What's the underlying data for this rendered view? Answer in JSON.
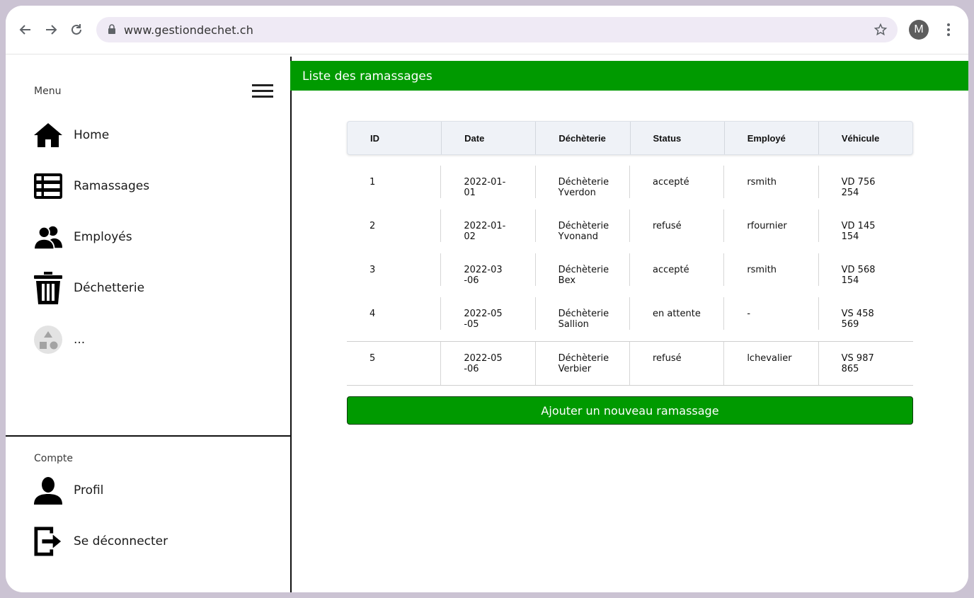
{
  "browser": {
    "url": "www.gestiondechet.ch",
    "avatar_letter": "M"
  },
  "sidebar": {
    "menu_label": "Menu",
    "items": [
      {
        "label": "Home",
        "icon": "home-icon"
      },
      {
        "label": "Ramassages",
        "icon": "list-icon"
      },
      {
        "label": "Employés",
        "icon": "users-icon"
      },
      {
        "label": "Déchetterie",
        "icon": "trash-icon"
      },
      {
        "label": "...",
        "icon": "shapes-icon"
      }
    ],
    "account_label": "Compte",
    "account_items": [
      {
        "label": "Profil",
        "icon": "user-icon"
      },
      {
        "label": "Se déconnecter",
        "icon": "logout-icon"
      }
    ]
  },
  "main": {
    "title": "Liste des ramassages",
    "table": {
      "headers": [
        "ID",
        "Date",
        "Déchèterie",
        "Status",
        "Employé",
        "Véhicule"
      ],
      "rows": [
        [
          "1",
          "2022-01-01",
          "Déchèterie Yverdon",
          "accepté",
          "rsmith",
          "VD 756 254"
        ],
        [
          "2",
          "2022-01-02",
          "Déchèterie Yvonand",
          "refusé",
          "rfournier",
          "VD 145 154"
        ],
        [
          "3",
          "2022-03 -06",
          "Déchèterie Bex",
          "accepté",
          "rsmith",
          "VD 568 154"
        ],
        [
          "4",
          "2022-05 -05",
          "Déchèterie Sallion",
          "en attente",
          "-",
          "VS 458 569"
        ],
        [
          "5",
          "2022-05 -06",
          "Déchèterie Verbier",
          "refusé",
          "lchevalier",
          "VS 987 865"
        ]
      ]
    },
    "add_button": "Ajouter un nouveau ramassage"
  },
  "colors": {
    "accent": "#009a00",
    "frame": "#cbc3d3"
  }
}
